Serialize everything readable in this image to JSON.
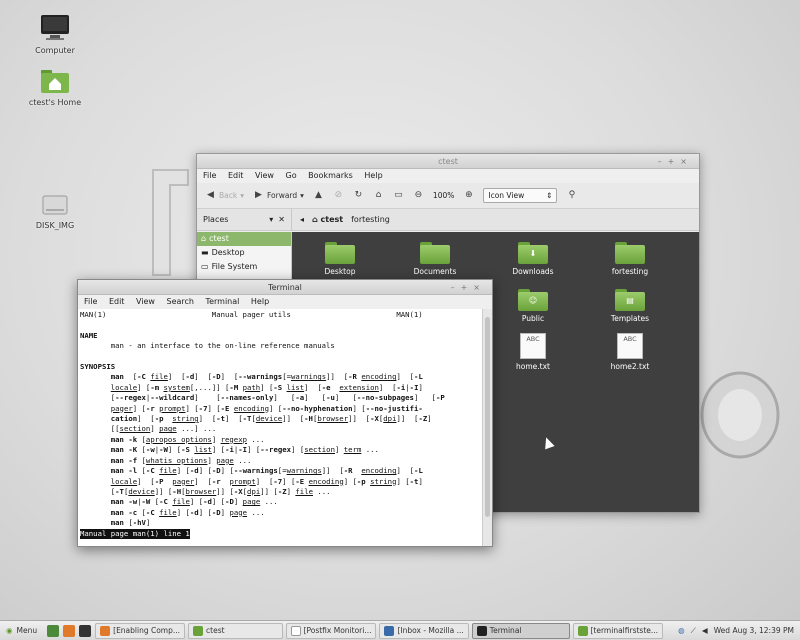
{
  "desktop": {
    "icons": [
      {
        "name": "computer",
        "label": "Computer"
      },
      {
        "name": "home",
        "label": "ctest's Home"
      },
      {
        "name": "disk",
        "label": "DISK_IMG"
      }
    ]
  },
  "file_manager": {
    "title": "ctest",
    "menu": [
      "File",
      "Edit",
      "View",
      "Go",
      "Bookmarks",
      "Help"
    ],
    "toolbar": {
      "back": "Back",
      "forward": "Forward",
      "zoom": "100%",
      "view": "Icon View"
    },
    "places_label": "Places",
    "path": [
      "ctest",
      "fortesting"
    ],
    "sidebar": [
      "ctest",
      "Desktop",
      "File System"
    ],
    "files": [
      {
        "name": "Desktop",
        "kind": "folder"
      },
      {
        "name": "Documents",
        "kind": "folder"
      },
      {
        "name": "Downloads",
        "kind": "folder"
      },
      {
        "name": "fortesting",
        "kind": "folder"
      },
      {
        "name": "Public",
        "kind": "folder"
      },
      {
        "name": "Templates",
        "kind": "folder"
      },
      {
        "name": "home.txt",
        "kind": "text"
      },
      {
        "name": "home2.txt",
        "kind": "text"
      }
    ],
    "text_icon_label": "ABC"
  },
  "terminal": {
    "title": "Terminal",
    "menu": [
      "File",
      "Edit",
      "View",
      "Search",
      "Terminal",
      "Help"
    ],
    "header_left": "MAN(1)",
    "header_center": "Manual pager utils",
    "header_right": "MAN(1)",
    "section_name": "NAME",
    "name_line": "man - an interface to the on-line reference manuals",
    "section_synopsis": "SYNOPSIS",
    "status": "Manual page man(1) line 1"
  },
  "taskbar": {
    "menu_label": "Menu",
    "tasks": [
      "[Enabling Comp...",
      "ctest",
      "[Postfix Monitori...",
      "[Inbox - Mozilla ...",
      "Terminal",
      "[terminalfirstste..."
    ],
    "clock": "Wed Aug  3, 12:39 PM"
  },
  "colors": {
    "accent": "#8db86b",
    "folder": "#6aa23a",
    "content_bg": "#3f3f3f"
  }
}
